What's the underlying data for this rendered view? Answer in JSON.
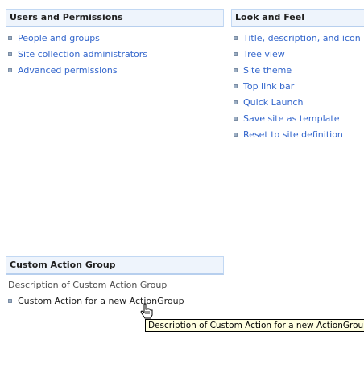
{
  "users_permissions": {
    "title": "Users and Permissions",
    "links": [
      {
        "label": "People and groups"
      },
      {
        "label": "Site collection administrators"
      },
      {
        "label": "Advanced permissions"
      }
    ]
  },
  "look_and_feel": {
    "title": "Look and Feel",
    "links": [
      {
        "label": "Title, description, and icon"
      },
      {
        "label": "Tree view"
      },
      {
        "label": "Site theme"
      },
      {
        "label": "Top link bar"
      },
      {
        "label": "Quick Launch"
      },
      {
        "label": "Save site as template"
      },
      {
        "label": "Reset to site definition"
      }
    ]
  },
  "custom_group": {
    "title": "Custom Action Group",
    "description": "Description of Custom Action Group",
    "links": [
      {
        "label": "Custom Action for a new ActionGroup"
      }
    ],
    "tooltip": "Description of Custom Action for a new ActionGroup"
  },
  "colors": {
    "header_bg": "#eef4fc",
    "header_border": "#c2d8f3",
    "link": "#3366cc",
    "tooltip_bg": "#ffffe1"
  },
  "icons": {
    "cursor": "hand-pointer-icon",
    "bullet": "square-bullet-icon"
  }
}
